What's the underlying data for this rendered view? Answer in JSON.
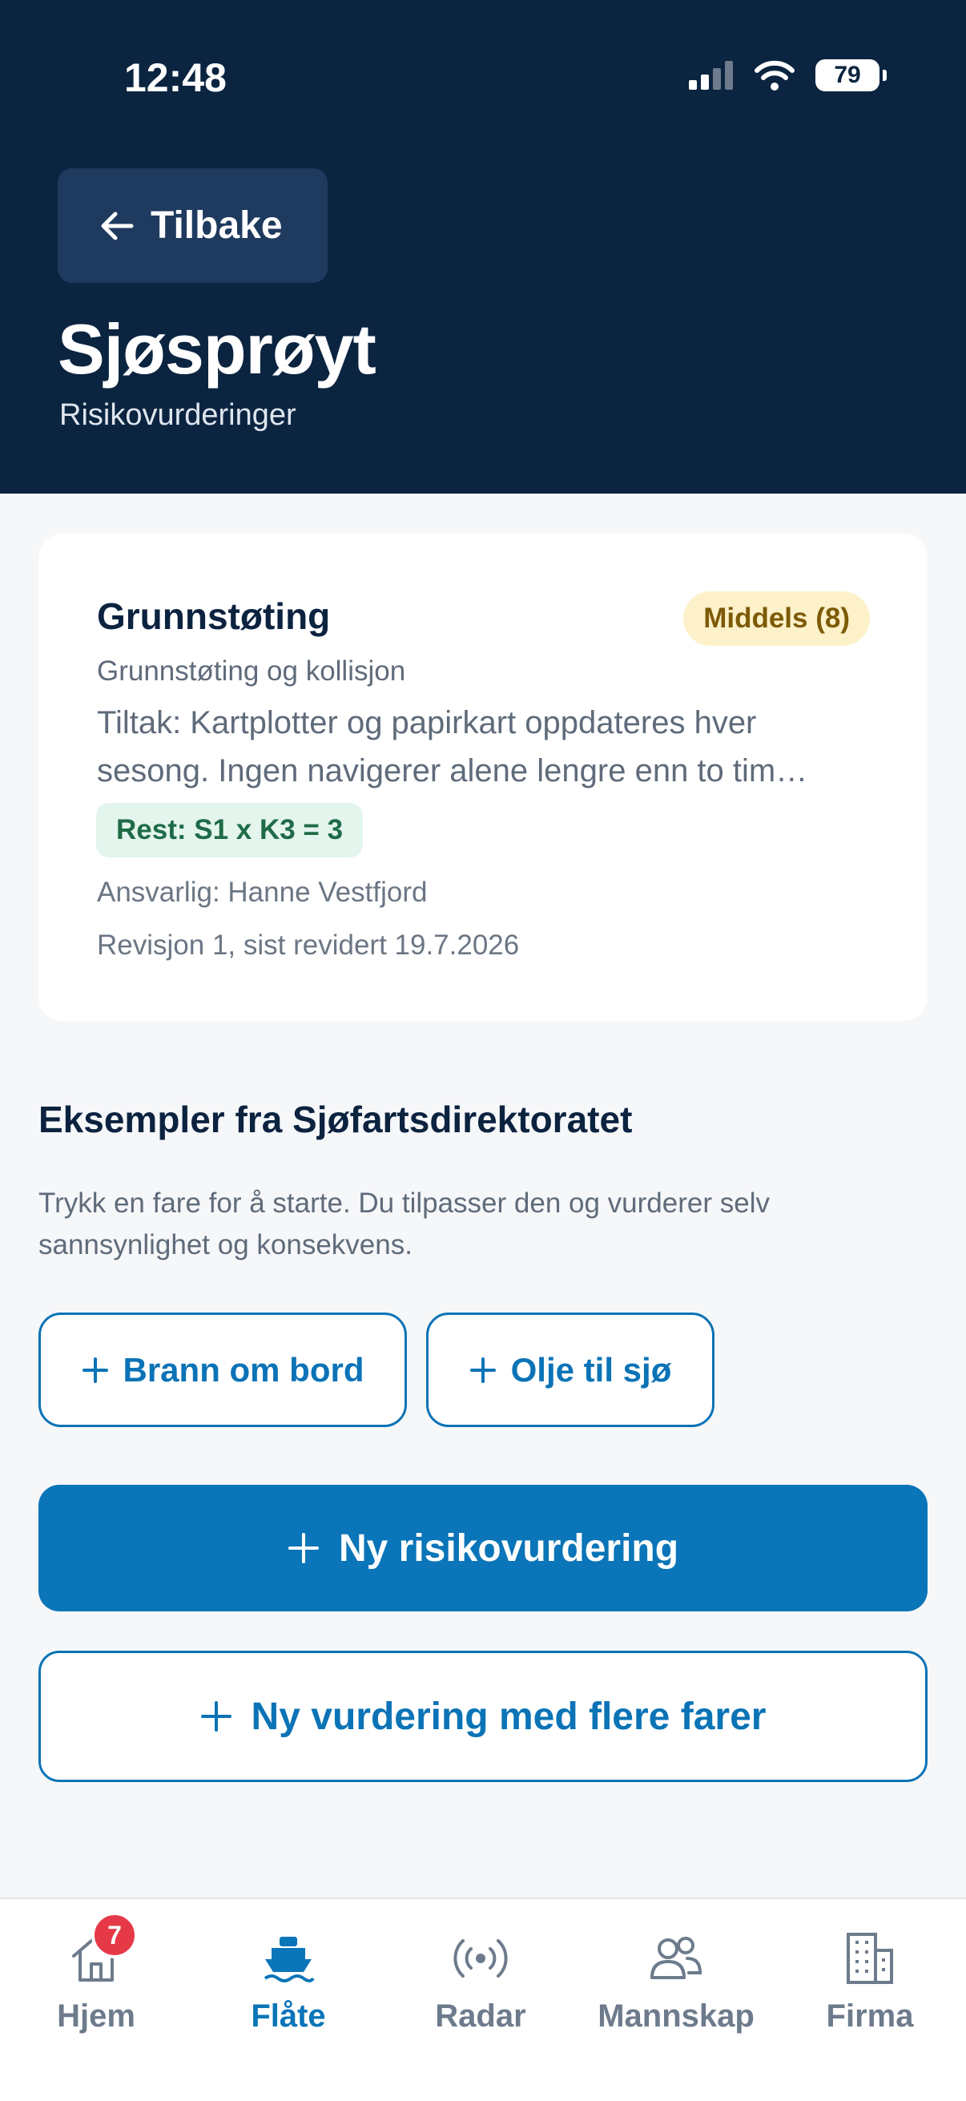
{
  "status_bar": {
    "time": "12:48",
    "battery": "79"
  },
  "header": {
    "back_label": "Tilbake",
    "title": "Sjøsprøyt",
    "subtitle": "Risikovurderinger"
  },
  "risk_card": {
    "title": "Grunnstøting",
    "level_badge": "Middels (8)",
    "category": "Grunnstøting og kollisjon",
    "action_line1": "Tiltak: Kartplotter og papirkart oppdateres hver",
    "action_line2": "sesong. Ingen navigerer alene lengre enn to tim…",
    "residual_badge": "Rest: S1 x K3 = 3",
    "responsible": "Ansvarlig: Hanne Vestfjord",
    "revision": "Revisjon 1, sist revidert 19.7.2026"
  },
  "examples": {
    "title": "Eksempler fra Sjøfartsdirektoratet",
    "description": "Trykk en fare for å starte. Du tilpasser den og vurderer selv sannsynlighet og konsekvens.",
    "chips": [
      "Brann om bord",
      "Olje til sjø"
    ]
  },
  "actions": {
    "new_assessment": "Ny risikovurdering",
    "new_multi_assessment": "Ny vurdering med flere farer"
  },
  "tabs": [
    {
      "label": "Hjem",
      "icon": "home-icon",
      "badge": "7"
    },
    {
      "label": "Flåte",
      "icon": "boat-icon",
      "active": true
    },
    {
      "label": "Radar",
      "icon": "radar-icon"
    },
    {
      "label": "Mannskap",
      "icon": "crew-icon"
    },
    {
      "label": "Firma",
      "icon": "building-icon"
    }
  ],
  "colors": {
    "header_bg": "#0b2440",
    "primary": "#0a75b8",
    "badge_mid_bg": "#fdf1c9",
    "badge_rest_bg": "#e3f5ed",
    "notif": "#e53948"
  }
}
